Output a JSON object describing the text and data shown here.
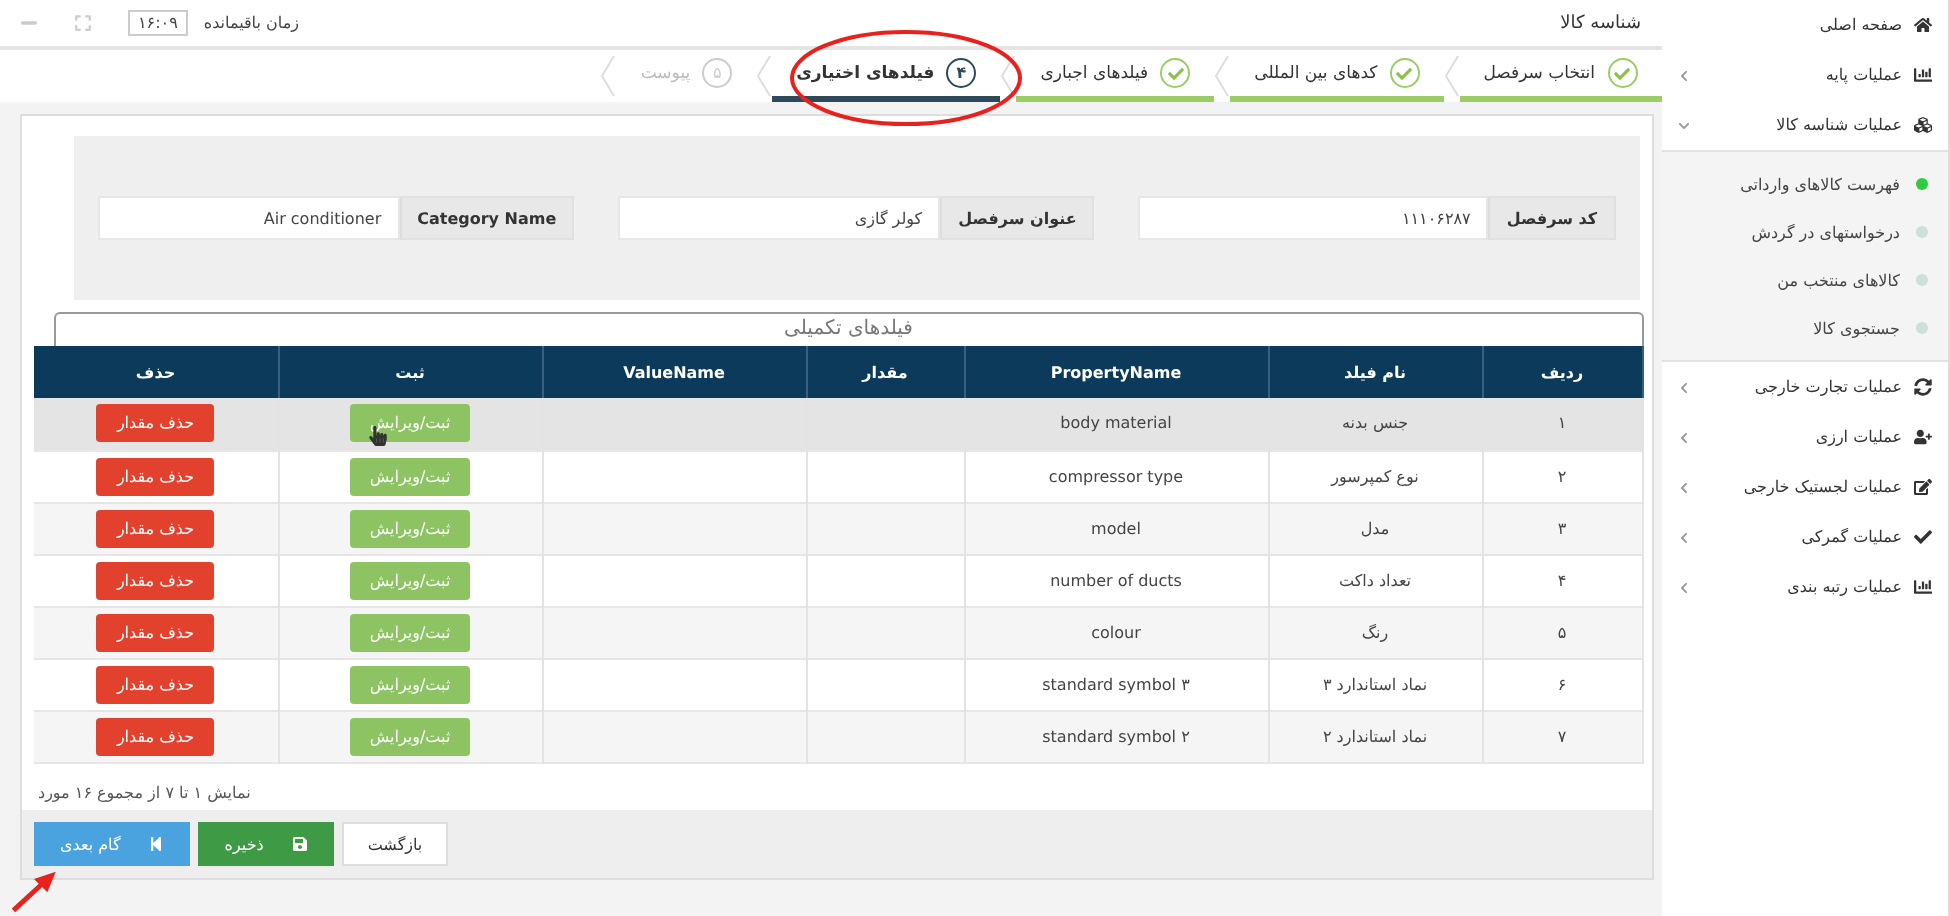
{
  "header": {
    "title": "شناسه کالا",
    "timer_label": "زمان باقیمانده",
    "timer_value": "۱۶:۰۹"
  },
  "steps": [
    {
      "label": "انتخاب سرفصل",
      "completed": true,
      "selected": false
    },
    {
      "label": "کدهای بین المللی",
      "completed": true,
      "selected": false
    },
    {
      "label": "فیلدهای اجباری",
      "completed": true,
      "selected": false
    },
    {
      "number": "۴",
      "label": "فیلدهای اختیاری",
      "completed": false,
      "selected": true
    },
    {
      "number": "۵",
      "label": "پیوست",
      "completed": false,
      "selected": false
    }
  ],
  "form_fields": [
    {
      "label": "کد سرفصل",
      "value": "۱۱۱۰۶۲۸۷"
    },
    {
      "label": "عنوان سرفصل",
      "value": "کولر گازی"
    },
    {
      "label": "Category Name",
      "value": "Air conditioner"
    }
  ],
  "table": {
    "caption": "فیلدهای تکمیلی",
    "columns": [
      "ردیف",
      "نام فیلد",
      "PropertyName",
      "مقدار",
      "ValueName",
      "ثبت",
      "حذف"
    ],
    "rows": [
      {
        "index": "۱",
        "field_name": "جنس بدنه",
        "property_name": "body material",
        "highlighted": true,
        "edit_button": "ثبت/ویرایش",
        "delete_button": "حذف مقدار"
      },
      {
        "index": "۲",
        "field_name": "نوع کمپرسور",
        "property_name": "compressor type",
        "highlighted": false,
        "edit_button": "ثبت/ویرایش",
        "delete_button": "حذف مقدار"
      },
      {
        "index": "۳",
        "field_name": "مدل",
        "property_name": "model",
        "highlighted": false,
        "edit_button": "ثبت/ویرایش",
        "delete_button": "حذف مقدار"
      },
      {
        "index": "۴",
        "field_name": "تعداد داکت",
        "property_name": "number of ducts",
        "highlighted": false,
        "edit_button": "ثبت/ویرایش",
        "delete_button": "حذف مقدار"
      },
      {
        "index": "۵",
        "field_name": "رنگ",
        "property_name": "colour",
        "highlighted": false,
        "edit_button": "ثبت/ویرایش",
        "delete_button": "حذف مقدار"
      },
      {
        "index": "۶",
        "field_name": "نماد استاندارد ۳",
        "property_name": "standard symbol ۳",
        "highlighted": false,
        "edit_button": "ثبت/ویرایش",
        "delete_button": "حذف مقدار"
      },
      {
        "index": "۷",
        "field_name": "نماد استاندارد ۲",
        "property_name": "standard symbol ۲",
        "highlighted": false,
        "edit_button": "ثبت/ویرایش",
        "delete_button": "حذف مقدار"
      }
    ],
    "footer": "نمایش ۱ تا ۷ از مجموع ۱۶ مورد"
  },
  "actions": [
    {
      "label": "بازگشت",
      "kind": "default"
    },
    {
      "label": "ذخیره",
      "kind": "success"
    },
    {
      "label": "گام بعدی",
      "kind": "primary"
    }
  ],
  "sidebar": {
    "items": [
      {
        "label": "صفحه اصلی"
      },
      {
        "label": "عملیات پایه",
        "expanded": false
      },
      {
        "label": "عملیات شناسه کالا",
        "expanded": true,
        "children": [
          {
            "label": "فهرست کالاهای وارداتی",
            "selected": true
          },
          {
            "label": "درخواستهای در گردش",
            "selected": false
          },
          {
            "label": "کالاهای منتخب من",
            "selected": false
          },
          {
            "label": "جستجوی کالا",
            "selected": false
          }
        ]
      },
      {
        "label": "عملیات تجارت خارجی",
        "expanded": false
      },
      {
        "label": "عملیات ارزی",
        "expanded": false
      },
      {
        "label": "عملیات لجستیک خارجی",
        "expanded": false
      },
      {
        "label": "عملیات گمرکی",
        "expanded": false
      },
      {
        "label": "عملیات رتبه بندی",
        "expanded": false
      }
    ]
  }
}
